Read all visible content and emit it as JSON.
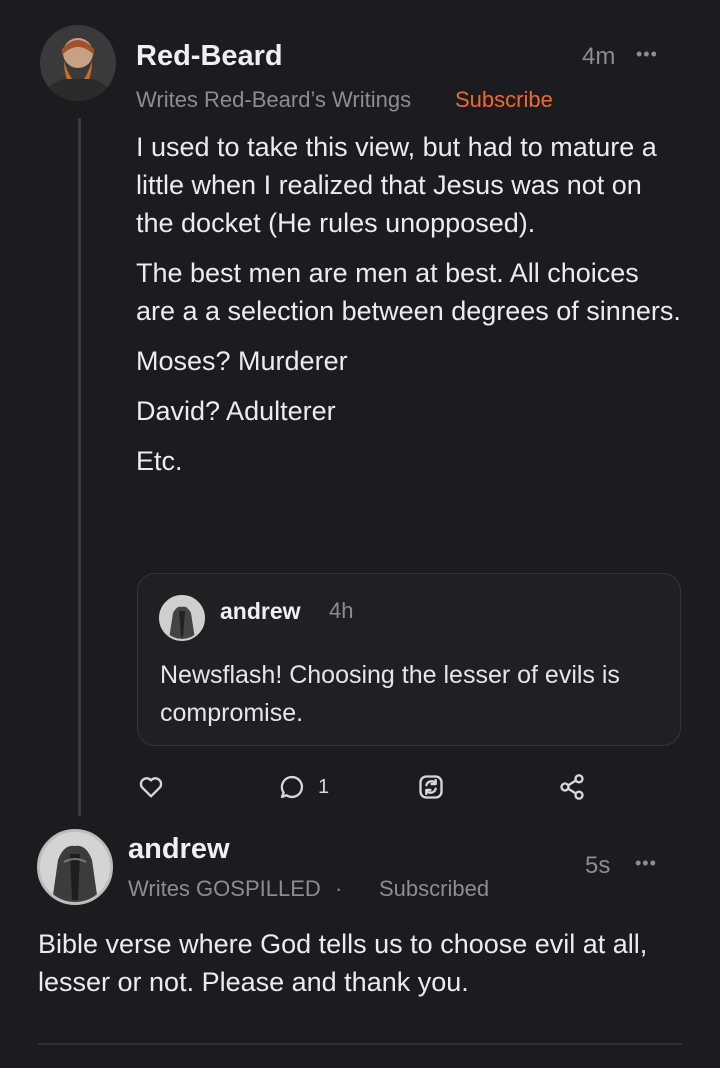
{
  "comment": {
    "author": "Red-Beard",
    "time": "4m",
    "more": "•••",
    "subtitle": "Writes Red-Beard’s Writings",
    "subscribe": "Subscribe",
    "paragraphs": [
      "I used to take this view, but had to mature a little when I realized that Jesus was not on the docket (He rules unopposed).",
      "The best men are men at best. All choices are a a selection between degrees of sinners.",
      "Moses? Murderer",
      "David? Adulterer",
      "Etc."
    ],
    "quote": {
      "author": "andrew",
      "time": "4h",
      "text": "Newsflash! Choosing the lesser of evils is compromise."
    },
    "actions": {
      "like_icon": "heart-icon",
      "reply_icon": "comment-bubble-icon",
      "reply_count": "1",
      "restack_icon": "restack-icon",
      "share_icon": "share-icon"
    }
  },
  "reply": {
    "author": "andrew",
    "time": "5s",
    "more": "•••",
    "subtitle": "Writes GOSPILLED",
    "dot": "·",
    "subscribed": "Subscribed",
    "text": "Bible verse where God tells us to choose evil at all, lesser or not. Please and thank you."
  },
  "colors": {
    "background": "#1c1b20",
    "accent_subscribe": "#f06a2b",
    "text": "#ececee",
    "muted": "#8c8c93"
  }
}
